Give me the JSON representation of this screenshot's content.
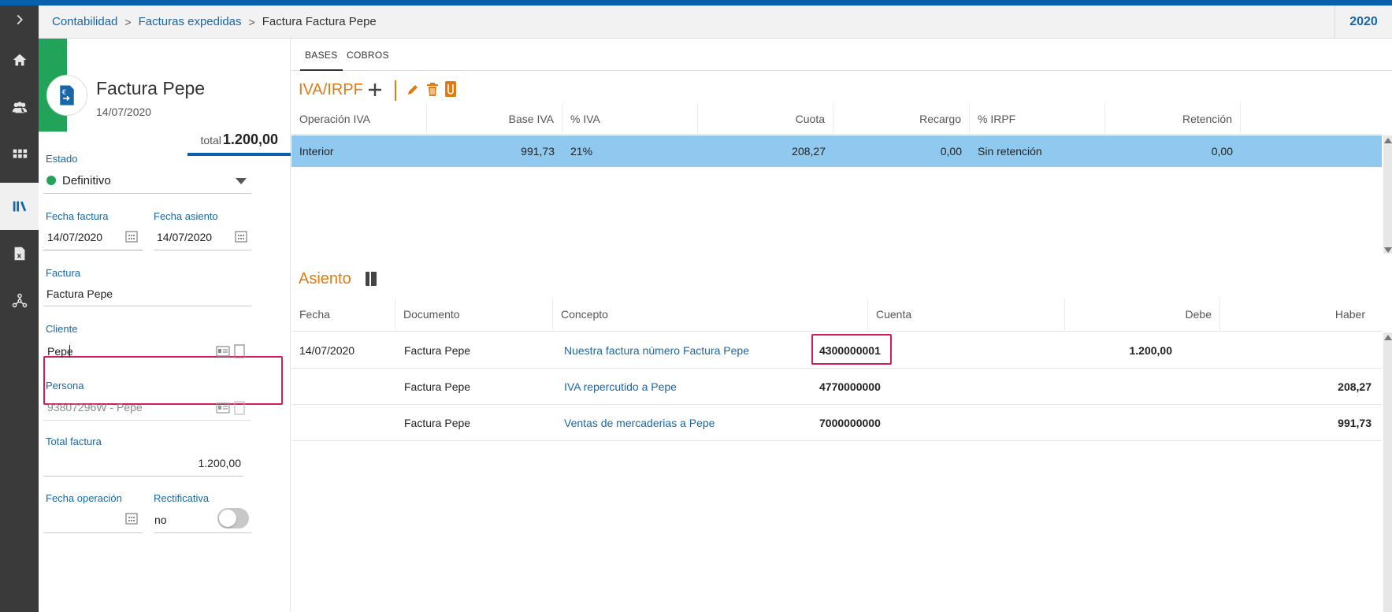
{
  "breadcrumb": {
    "items": [
      "Contabilidad",
      "Facturas expedidas"
    ],
    "current": "Factura Factura Pepe",
    "year": "2020"
  },
  "rail": {
    "icons": [
      "chevron-right-icon",
      "home-icon",
      "users-icon",
      "apps-grid-icon",
      "library-icon",
      "excel-file-icon",
      "network-icon"
    ],
    "active": "library-icon"
  },
  "invoice": {
    "title": "Factura Pepe",
    "date": "14/07/2020",
    "total_label": "total",
    "total_value": "1.200,00"
  },
  "form": {
    "estado": {
      "label": "Estado",
      "value": "Definitivo",
      "status_color": "#21a35a"
    },
    "fecha_factura": {
      "label": "Fecha factura",
      "value": "14/07/2020"
    },
    "fecha_asiento": {
      "label": "Fecha asiento",
      "value": "14/07/2020"
    },
    "factura": {
      "label": "Factura",
      "value": "Factura Pepe"
    },
    "cliente": {
      "label": "Cliente",
      "value": "Pepe"
    },
    "persona": {
      "label": "Persona",
      "value": "93807296W - Pepe"
    },
    "total_factura": {
      "label": "Total factura",
      "value": "1.200,00"
    },
    "fecha_operacion": {
      "label": "Fecha operación",
      "value": ""
    },
    "rectificativa": {
      "label": "Rectificativa",
      "value": "no"
    }
  },
  "tabs": [
    {
      "label": "BASES",
      "active": true
    },
    {
      "label": "COBROS",
      "active": false
    }
  ],
  "iva_section": {
    "title": "IVA/IRPF",
    "toolbar": [
      "add-icon",
      "edit-icon",
      "delete-icon",
      "attach-icon"
    ],
    "columns": [
      "Operación IVA",
      "Base IVA",
      "% IVA",
      "Cuota",
      "Recargo",
      "% IRPF",
      "Retención"
    ],
    "rows": [
      {
        "operacion": "Interior",
        "base": "991,73",
        "iva": "21%",
        "cuota": "208,27",
        "recargo": "0,00",
        "irpf": "Sin retención",
        "retencion": "0,00"
      }
    ]
  },
  "asiento_section": {
    "title": "Asiento",
    "columns": [
      "Fecha",
      "Documento",
      "Concepto",
      "Cuenta",
      "Debe",
      "Haber"
    ],
    "rows": [
      {
        "fecha": "14/07/2020",
        "documento": "Factura Pepe",
        "concepto": "Nuestra factura número Factura Pepe",
        "cuenta": "4300000001",
        "debe": "1.200,00",
        "haber": ""
      },
      {
        "fecha": "",
        "documento": "Factura Pepe",
        "concepto": "IVA repercutido a Pepe",
        "cuenta": "4770000000",
        "debe": "",
        "haber": "208,27"
      },
      {
        "fecha": "",
        "documento": "Factura Pepe",
        "concepto": "Ventas de mercaderias a Pepe",
        "cuenta": "7000000000",
        "debe": "",
        "haber": "991,73"
      }
    ]
  },
  "colors": {
    "brand_blue": "#0a5fad",
    "accent_orange": "#e07b14",
    "highlight_pink": "#d21d5a",
    "selected_row": "#8fc9ef"
  }
}
